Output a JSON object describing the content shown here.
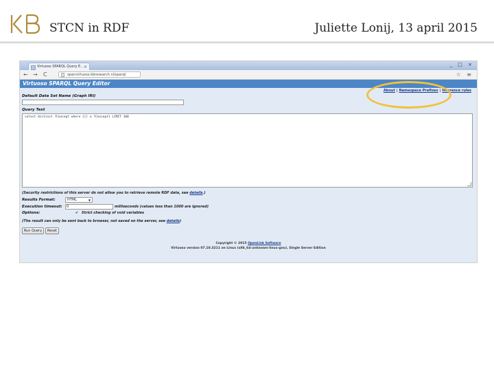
{
  "slide": {
    "logo_text": "KB",
    "title": "STCN in RDF",
    "author_date": "Juliette Lonij, 13 april 2015"
  },
  "browser": {
    "tab_title": "Virtuoso SPARQL Query E...",
    "tab_close": "×",
    "window_controls": "_ □ ×",
    "back": "←",
    "forward": "→",
    "reload": "C",
    "address": "openvirtuoso.kbresearch.nl/sparql",
    "nav_right": "☆ ≡"
  },
  "page": {
    "heading": "Virtuoso SPARQL Query Editor",
    "links": [
      "About",
      "Namespace Prefixes",
      "Inference rules"
    ],
    "link_sep": "|",
    "graph_label": "Default Data Set Name (Graph IRI)",
    "query_label": "Query Text",
    "query_text": "select distinct ?Concept where {[] a ?Concept} LIMIT 100",
    "security_note_pre": "(Security restrictions of this server do not allow you to retrieve remote RDF data, see ",
    "security_note_link": "details",
    "security_note_post": ".)",
    "results_format_label": "Results Format:",
    "results_format_value": "HTML",
    "select_caret": "▼",
    "timeout_label": "Execution timeout:",
    "timeout_value": "0",
    "timeout_note": "milliseconds (values less than 1000 are ignored)",
    "options_label": "Options:",
    "checkbox_mark": "✔",
    "strict_label": "Strict checking of void variables",
    "result_note_pre": "(The result can only be sent back to browser, not saved on the server, see ",
    "result_note_link": "details",
    "result_note_post": ")",
    "run_button": "Run Query",
    "reset_button": "Reset",
    "copyright_pre": "Copyright © 2015 ",
    "copyright_link": "OpenLink Software",
    "version": "Virtuoso version 07.10.3211 on Linux (x86_64-unknown-linux-gnu), Single Server Edition"
  },
  "colors": {
    "title_bar": "#4d86c6",
    "page_bg": "#e2eaf5",
    "highlight": "#f2c13b",
    "link": "#15378a"
  }
}
